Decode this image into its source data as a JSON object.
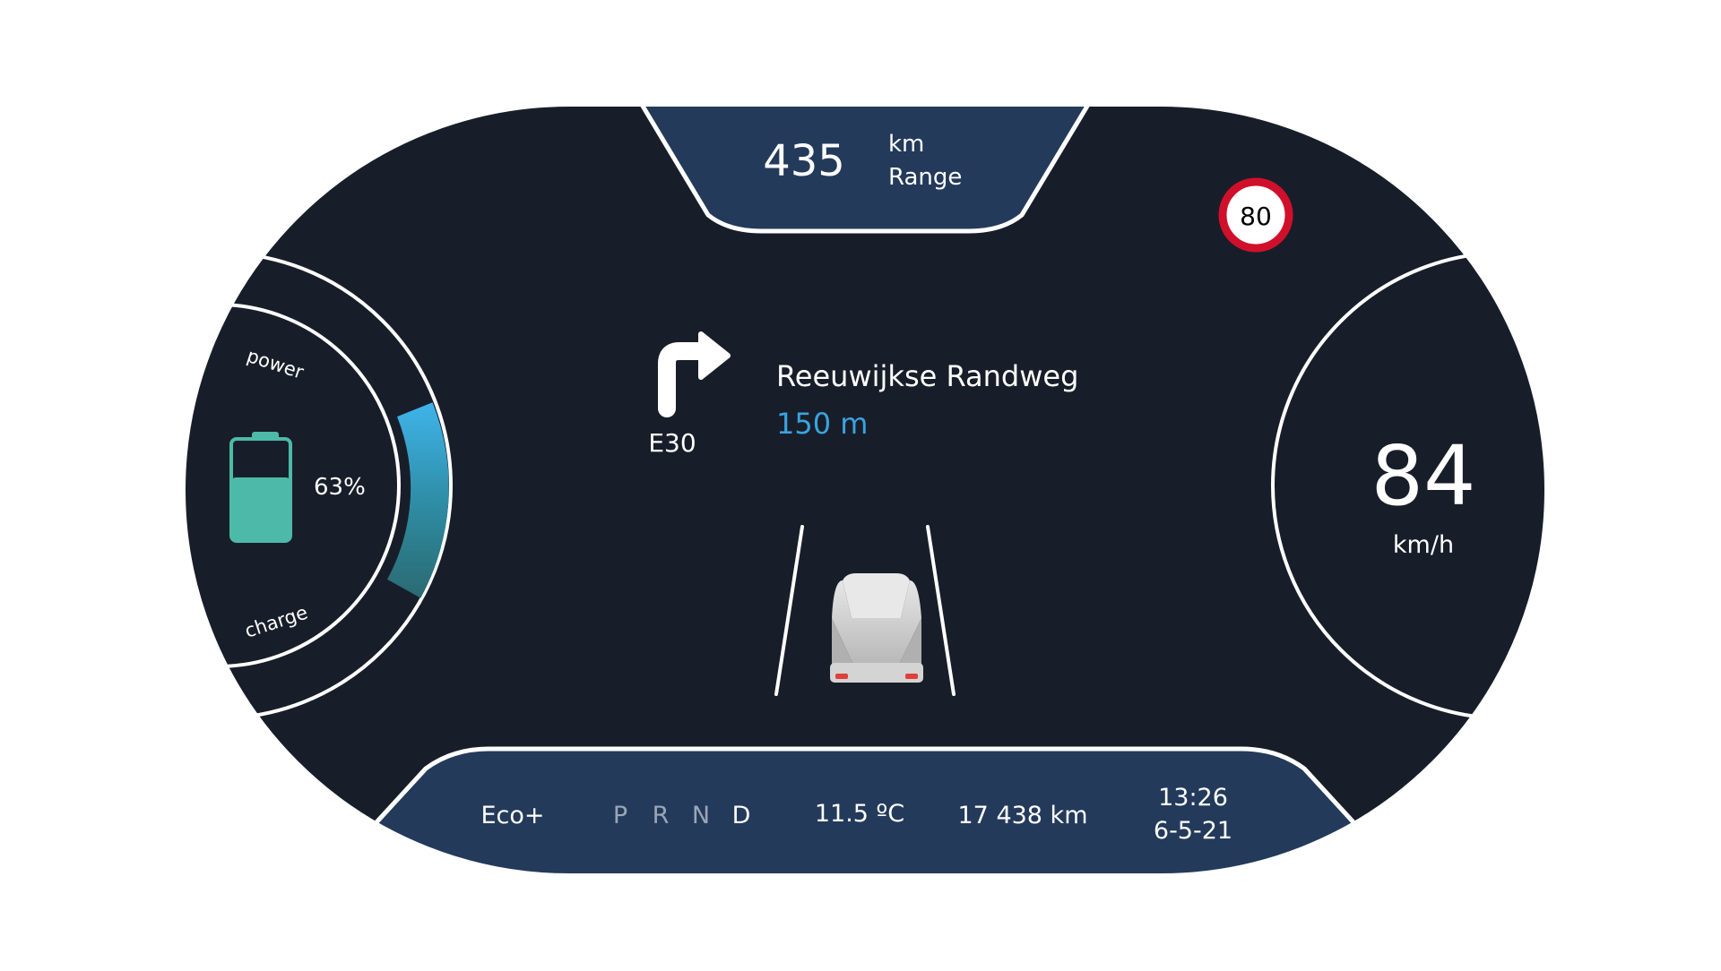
{
  "colors": {
    "page_background": "#ffffff",
    "dashboard_background": "#181e29",
    "panel_blue": "#233a5b",
    "outline_white": "#ffffff",
    "accent_blue": "#3aa3e0",
    "battery_teal": "#4dbaa9",
    "speed_sign_red": "#d0102a",
    "gear_inactive": "#9aa6b6",
    "gear_active": "#ffffff",
    "car_body": "#cfcfcf",
    "car_lights": "#e0403a"
  },
  "range": {
    "value": "435",
    "unit": "km",
    "label": "Range"
  },
  "speed_limit": {
    "value": "80",
    "icon": "speed-limit-sign-icon"
  },
  "power_gauge": {
    "top_label": "power",
    "bottom_label": "charge",
    "battery_percent_text": "63%",
    "battery_level": 0.63,
    "battery_icon": "battery-icon"
  },
  "navigation": {
    "turn_icon": "turn-right-arrow-icon",
    "road_code": "E30",
    "street_name": "Reeuwijkse Randweg",
    "distance": "150 m"
  },
  "lane_view": {
    "car_icon": "car-icon",
    "lane_icon": "lane-line-icon"
  },
  "speedometer": {
    "value": "84",
    "unit": "km/h"
  },
  "status_bar": {
    "drive_mode": "Eco+",
    "gears": [
      {
        "label": "P",
        "active": false
      },
      {
        "label": "R",
        "active": false
      },
      {
        "label": "N",
        "active": false
      },
      {
        "label": "D",
        "active": true
      }
    ],
    "temperature": "11.5 ºC",
    "odometer": "17 438 km",
    "time": "13:26",
    "date": "6-5-21"
  }
}
